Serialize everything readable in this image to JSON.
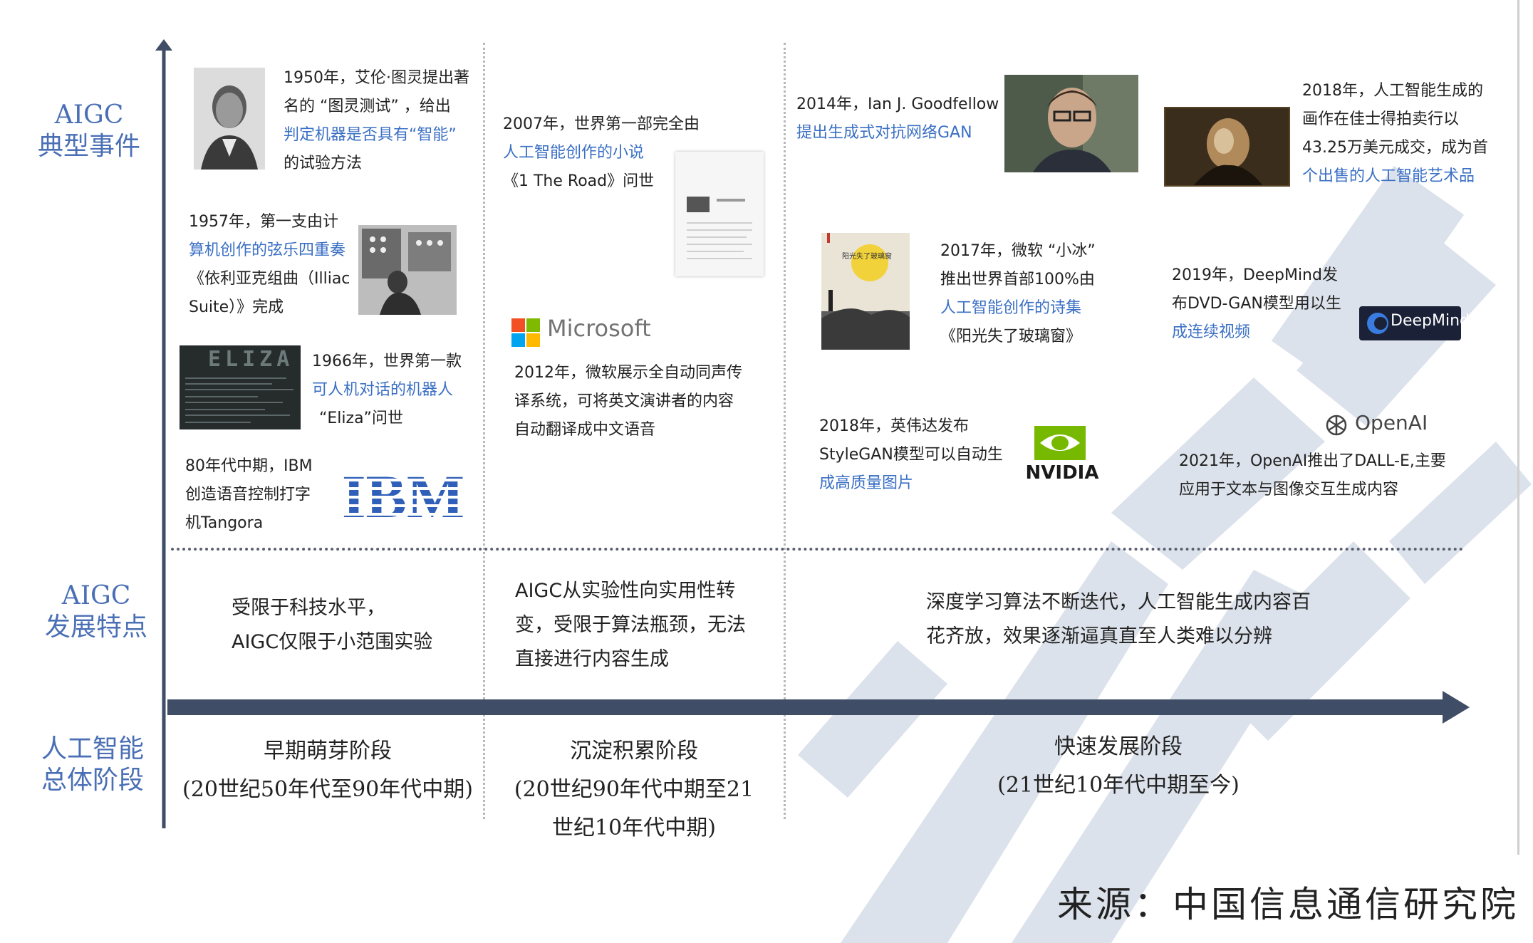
{
  "row_labels": {
    "events": [
      "AIGC",
      "典型事件"
    ],
    "features": [
      "AIGC",
      "发展特点"
    ],
    "stages": [
      "人工智能",
      "总体阶段"
    ]
  },
  "events": {
    "e1950": {
      "parts": [
        "1950年，艾伦·图灵提出著",
        "名的 “图灵测试” ，给出",
        "判定机器是否具有“智能”",
        "的试验方法"
      ],
      "highlight": [
        2
      ]
    },
    "e1957": {
      "lines": [
        "1957年，第一支由计",
        "算机创作的弦乐四重奏",
        "《依利亚克组曲（Illiac",
        "Suite）》完成"
      ]
    },
    "e1966": {
      "lines": [
        "1966年，世界第一款",
        "可人机对话的机器人",
        "“Eliza”问世"
      ]
    },
    "e80s": {
      "lines": [
        "80年代中期，IBM",
        "创造语音控制打字",
        "机Tangora"
      ]
    },
    "e2007": {
      "lines": [
        "2007年，世界第一部完全由",
        "人工智能创作的小说",
        "《1 The Road》问世"
      ]
    },
    "e2012": {
      "lines": [
        "2012年，微软展示全自动同声传",
        "译系统，可将英文演讲者的内容",
        "自动翻译成中文语音"
      ]
    },
    "e2014": {
      "lines": [
        "2014年，Ian J. Goodfellow",
        "提出生成式对抗网络GAN"
      ]
    },
    "e2017": {
      "lines": [
        "2017年，微软 “小冰”",
        "推出世界首部100%由",
        "人工智能创作的诗集",
        "《阳光失了玻璃窗》"
      ]
    },
    "e2018n": {
      "lines": [
        "2018年，英伟达发布",
        "StyleGAN模型可以自动生",
        "成高质量图片"
      ]
    },
    "e2018a": {
      "lines": [
        "2018年，人工智能生成的",
        "画作在佳士得拍卖行以",
        "43.25万美元成交，成为首",
        "个出售的人工智能艺术品"
      ]
    },
    "e2019": {
      "lines": [
        "2019年，DeepMind发",
        "布DVD-GAN模型用以生",
        "成连续视频"
      ]
    },
    "e2021": {
      "lines": [
        "2021年，OpenAI推出了DALL-E,主要",
        "应用于文本与图像交互生成内容"
      ]
    }
  },
  "highlights": {
    "e1957": [
      "计",
      "算机创作的弦乐四重奏"
    ],
    "e1966": [
      "第一款",
      "可人机对话的机器人"
    ],
    "e80s": [
      "语音控制打字",
      "机"
    ],
    "e2007": [
      "人工智能创作的小说"
    ],
    "e2012": [
      "全自动同声传",
      "译系统"
    ],
    "e2014": [
      "生成式对抗网络GAN"
    ],
    "e2017": [
      "首部100%由",
      "人工智能创作的诗集"
    ],
    "e2018n": [
      "自动生",
      "成高质量图片"
    ],
    "e2018a": [
      "首",
      "个出售的人工智能艺术品"
    ],
    "e2019": [
      "生",
      "成连续视频"
    ],
    "e2021": [
      "文本与图像交互生成内容"
    ]
  },
  "logos": {
    "eliza": "ELIZA",
    "ibm": "IBM",
    "microsoft": "Microsoft",
    "nvidia": "NVIDIA",
    "deepmind": "DeepMind",
    "openai": "OpenAI",
    "book_title": "1 the Road",
    "poem_cover": "阳光失了玻璃窗"
  },
  "features": {
    "early": [
      "受限于科技水平，",
      "AIGC仅限于小范围实验"
    ],
    "accum": [
      "AIGC从实验性向实用性转",
      "变，受限于算法瓶颈，无法",
      "直接进行内容生成"
    ],
    "fast": [
      "深度学习算法不断迭代，人工智能生成内容百",
      "花齐放，效果逐渐逼真直至人类难以分辨"
    ]
  },
  "stages": {
    "early": {
      "name": "早期萌芽阶段",
      "period": [
        "(20世纪50年代至90年代中期)"
      ]
    },
    "accum": {
      "name": "沉淀积累阶段",
      "period": [
        "(20世纪90年代中期至21",
        "世纪10年代中期)"
      ]
    },
    "fast": {
      "name": "快速发展阶段",
      "period": [
        "(21世纪10年代中期至今)"
      ]
    }
  },
  "source": "来源：中国信息通信研究院",
  "colors": {
    "accent": "#4a6fb5",
    "highlight": "#3a6fc4",
    "axis": "#3f4d66",
    "watermark": "#d6dde8"
  },
  "icons": [
    "turing-photo",
    "illiac-photo",
    "eliza-screen",
    "ibm-logo",
    "novel-page",
    "microsoft-logo",
    "goodfellow-photo",
    "poem-book-cover",
    "nvidia-logo",
    "ai-painting",
    "deepmind-logo",
    "openai-logo"
  ]
}
